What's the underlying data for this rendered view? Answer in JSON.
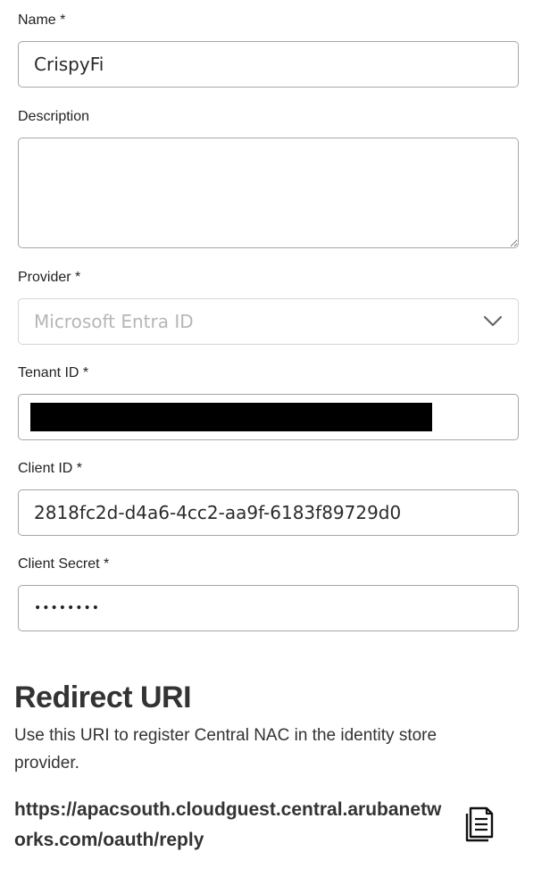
{
  "fields": {
    "name": {
      "label": "Name *",
      "value": "CrispyFi"
    },
    "description": {
      "label": "Description",
      "value": ""
    },
    "provider": {
      "label": "Provider *",
      "value": "Microsoft Entra ID"
    },
    "tenant_id": {
      "label": "Tenant ID *"
    },
    "client_id": {
      "label": "Client ID *",
      "value": "2818fc2d-d4a6-4cc2-aa9f-6183f89729d0"
    },
    "client_secret": {
      "label": "Client Secret *",
      "value": "••••••••"
    }
  },
  "redirect": {
    "title": "Redirect URI",
    "description": "Use this URI to register Central NAC in the identity store provider.",
    "uri": "https://apacsouth.cloudguest.central.arubanetworks.com/oauth/reply"
  },
  "icons": {
    "provider_dropdown": "chevron-down-icon",
    "copy": "copy-document-icon"
  }
}
